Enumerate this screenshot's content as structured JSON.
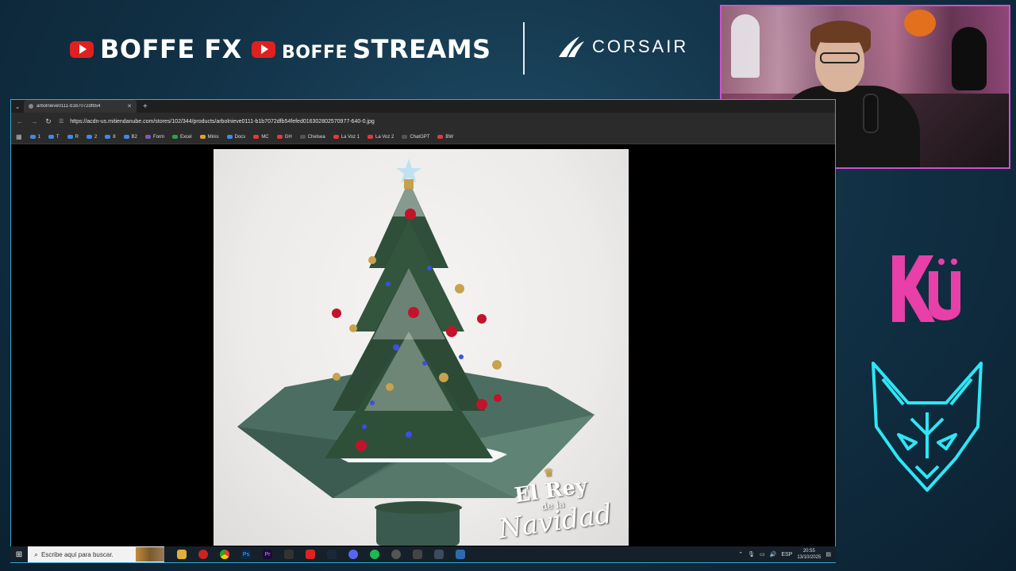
{
  "overlay": {
    "brand1": "BOFFE FX",
    "brand2_small": "BOFFE",
    "brand2_big": "STREAMS",
    "sponsor": "CORSAIR",
    "team_logo": "KRÜ",
    "brand_colors": {
      "youtube": "#e02020",
      "webcam_border": "#d14fd0",
      "kru": "#e83fa8",
      "fox": "#2ee6f5"
    }
  },
  "browser": {
    "tab_title": "arbolnieve0111-b1b7072dfb54",
    "new_tab": "+",
    "url": "https://acdn-us.mitiendanube.com/stores/102/344/products/arbolnieve0111-b1b7072dfb54fefed016302802570977-640-0.jpg",
    "bookmarks": [
      {
        "label": "1",
        "icon": "cloud-icon"
      },
      {
        "label": "T",
        "icon": "cloud-icon"
      },
      {
        "label": "R",
        "icon": "cloud-icon"
      },
      {
        "label": "2",
        "icon": "cloud-icon"
      },
      {
        "label": "8",
        "icon": "cloud-icon"
      },
      {
        "label": "B2",
        "icon": "cloud-icon"
      },
      {
        "label": "Form",
        "icon": "forms-icon"
      },
      {
        "label": "Excel",
        "icon": "excel-icon"
      },
      {
        "label": "Minis",
        "icon": "bookmark-icon"
      },
      {
        "label": "Docs",
        "icon": "docs-icon"
      },
      {
        "label": "MC",
        "icon": "bookmark-icon"
      },
      {
        "label": "GH",
        "icon": "bookmark-icon"
      },
      {
        "label": "Chelsea",
        "icon": "bookmark-icon"
      },
      {
        "label": "La Voz 1",
        "icon": "bookmark-icon"
      },
      {
        "label": "La Voz 2",
        "icon": "bookmark-icon"
      },
      {
        "label": "ChatGPT",
        "icon": "chatgpt-icon"
      },
      {
        "label": "BW",
        "icon": "bookmark-icon"
      }
    ],
    "image": {
      "watermark_line1": "El Rey",
      "watermark_line2": "de la",
      "watermark_line3": "Navidad"
    }
  },
  "taskbar": {
    "search_placeholder": "Escribe aquí para buscar.",
    "language": "ESP",
    "time": "20:55",
    "date": "13/10/2025"
  }
}
